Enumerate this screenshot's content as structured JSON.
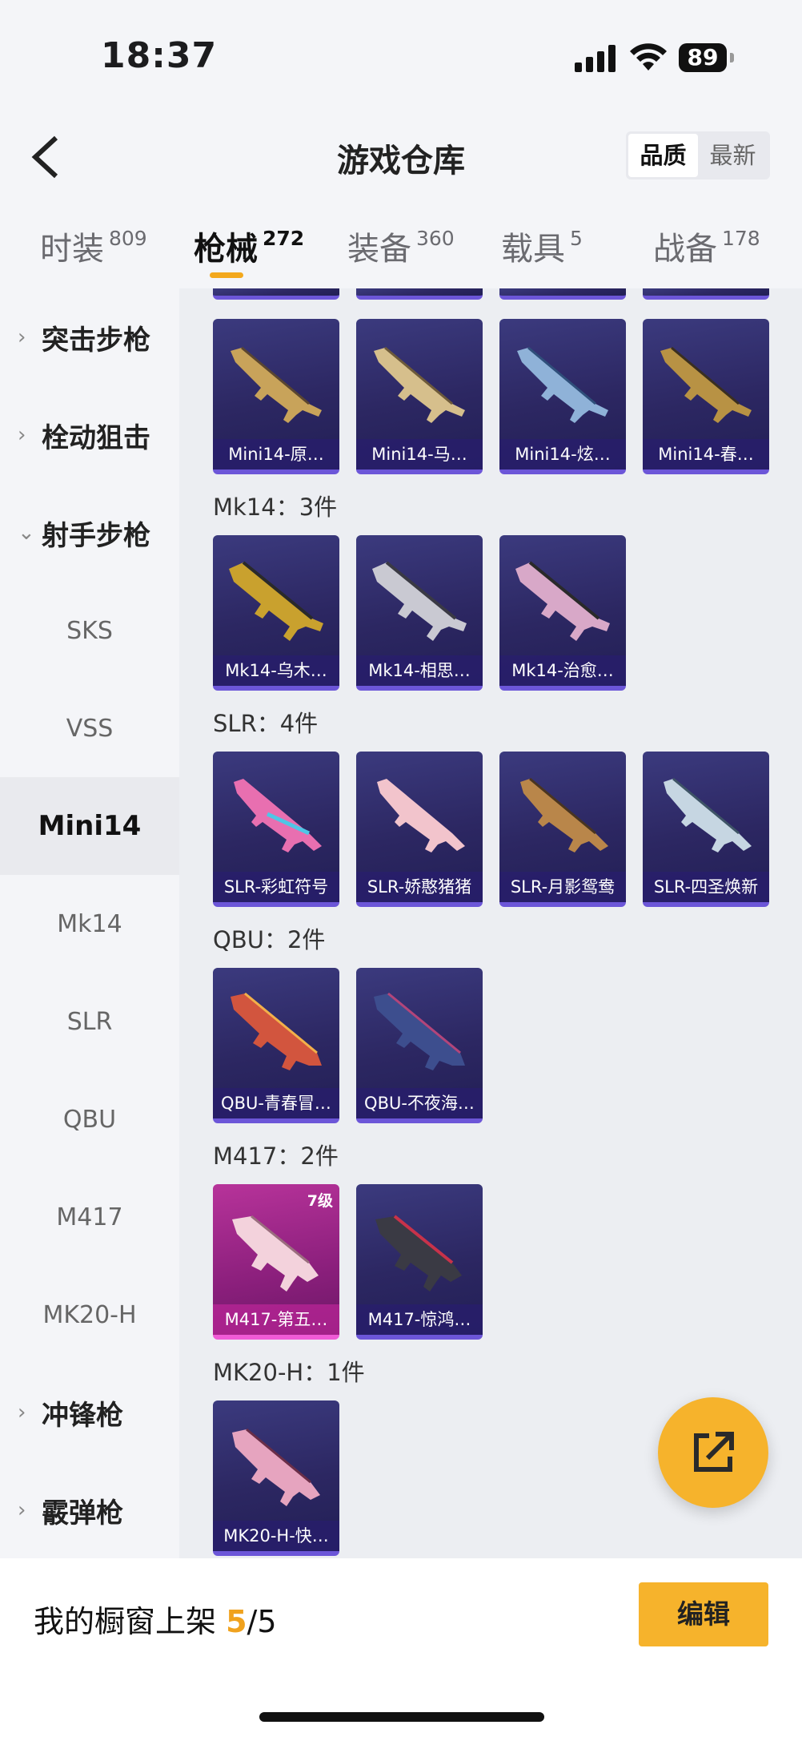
{
  "status": {
    "time": "18:37",
    "battery": "89"
  },
  "header": {
    "title": "游戏仓库",
    "sort_quality": "品质",
    "sort_newest": "最新"
  },
  "tabs": [
    {
      "label": "时装",
      "count": "809"
    },
    {
      "label": "枪械",
      "count": "272"
    },
    {
      "label": "装备",
      "count": "360"
    },
    {
      "label": "载具",
      "count": "5"
    },
    {
      "label": "战备",
      "count": "178"
    }
  ],
  "sidebar": {
    "categories": {
      "assault": "突击步枪",
      "bolt": "栓动狙击",
      "marksman": "射手步枪",
      "smg": "冲锋枪",
      "shotgun": "霰弹枪"
    },
    "subs": [
      "SKS",
      "VSS",
      "Mini14",
      "Mk14",
      "SLR",
      "QBU",
      "M417",
      "MK20-H"
    ]
  },
  "sections": {
    "mk14": "Mk14：3件",
    "slr": "SLR：4件",
    "qbu": "QBU：2件",
    "m417": "M417：2件",
    "mk20h": "MK20-H：1件"
  },
  "items": {
    "mini14": [
      "Mini14-原…",
      "Mini14-马…",
      "Mini14-炫…",
      "Mini14-春…"
    ],
    "mk14": [
      "Mk14-乌木…",
      "Mk14-相思…",
      "Mk14-治愈…"
    ],
    "slr": [
      "SLR-彩虹符号",
      "SLR-娇憨猪猪",
      "SLR-月影鸳鸯",
      "SLR-四圣焕新"
    ],
    "qbu": [
      "QBU-青春冒…",
      "QBU-不夜海…"
    ],
    "m417": [
      "M417-第五…",
      "M417-惊鸿…"
    ],
    "m417_level": "7级",
    "mk20h": [
      "MK20-H-快…"
    ]
  },
  "bottom": {
    "label": "我的橱窗上架 ",
    "count": "5",
    "total": "/5",
    "edit": "编辑"
  },
  "colors": {
    "accent": "#f6b32c",
    "card_bg": "#2c2762",
    "card_border": "#6c56d8",
    "rare_pink": "#b7339a"
  },
  "icons": {
    "back": "chevron-left-icon",
    "share": "external-link-icon"
  }
}
